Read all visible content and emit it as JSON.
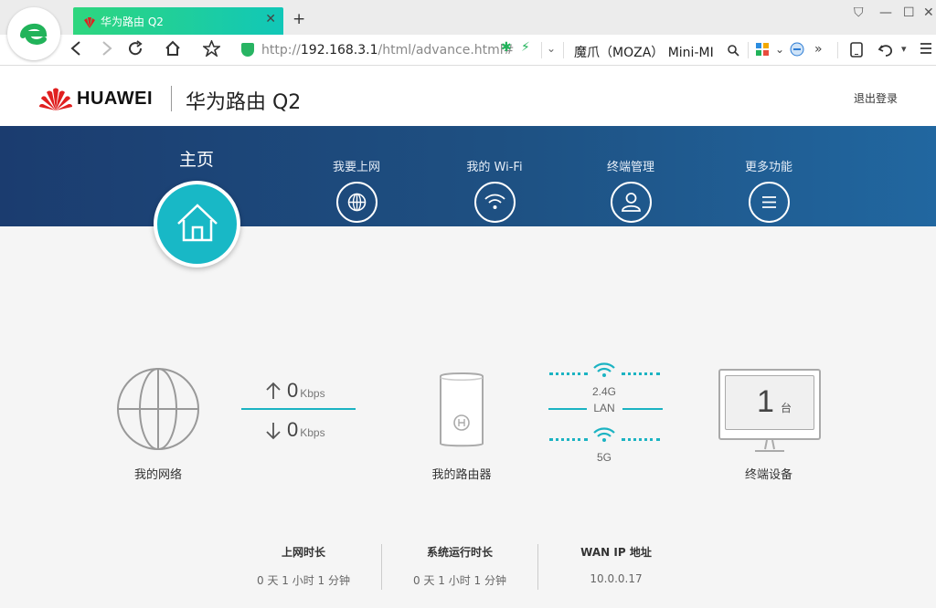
{
  "browser": {
    "tab_title": "华为路由 Q2",
    "url_prefix": "http://",
    "url_host": "192.168.3.1",
    "url_rest": "/html/advance.html#",
    "search_text": "魔爪（MOZA） Mini-MI",
    "icons": [
      "back-icon",
      "forward-icon",
      "reload-icon",
      "home-icon",
      "star-icon",
      "shield-icon",
      "search-icon",
      "undo-icon",
      "menu-icon"
    ]
  },
  "router": {
    "brand": "HUAWEI",
    "product": "华为路由 Q2",
    "logout": "退出登录",
    "nav": {
      "home": "主页",
      "internet": "我要上网",
      "wifi": "我的 Wi-Fi",
      "devices": "终端管理",
      "more": "更多功能"
    },
    "diagram": {
      "network_label": "我的网络",
      "upload_value": "0",
      "download_value": "0",
      "speed_unit": "Kbps",
      "router_label": "我的路由器",
      "band_24": "2.4G",
      "lan": "LAN",
      "band_5": "5G",
      "device_count": "1",
      "device_unit": "台",
      "devices_label": "终端设备"
    },
    "stats": {
      "online_title": "上网时长",
      "online_value": "0 天 1 小时 1 分钟",
      "uptime_title": "系统运行时长",
      "uptime_value": "0 天 1 小时 1 分钟",
      "wan_title": "WAN IP 地址",
      "wan_value": "10.0.0.17"
    },
    "colors": {
      "accent": "#18b8c6",
      "nav_band": "#1e5183",
      "brand_red": "#e02020"
    }
  }
}
